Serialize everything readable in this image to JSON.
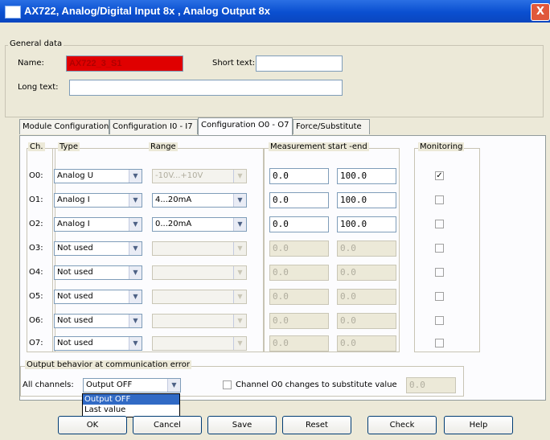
{
  "window": {
    "title": "AX722, Analog/Digital Input 8x , Analog Output 8x",
    "close_glyph": "X"
  },
  "general": {
    "group_title": "General data",
    "name_label": "Name:",
    "name_value": "AX722_3_S1",
    "short_text_label": "Short text:",
    "short_text_value": "",
    "long_text_label": "Long text:",
    "long_text_value": ""
  },
  "tabs": [
    {
      "label": "Module Configuration"
    },
    {
      "label": "Configuration I0 - I7"
    },
    {
      "label": "Configuration O0 - O7"
    },
    {
      "label": "Force/Substitute"
    }
  ],
  "columns": {
    "ch": "Ch.",
    "type": "Type",
    "range": "Range",
    "measurement": "Measurement start  -end",
    "monitoring": "Monitoring"
  },
  "rows": [
    {
      "ch": "O0:",
      "type": "Analog U",
      "range": "-10V...+10V",
      "start": "0.0",
      "end": "100.0",
      "monitor": "✓"
    },
    {
      "ch": "O1:",
      "type": "Analog I",
      "range": "4...20mA",
      "start": "0.0",
      "end": "100.0",
      "monitor": ""
    },
    {
      "ch": "O2:",
      "type": "Analog I",
      "range": "0...20mA",
      "start": "0.0",
      "end": "100.0",
      "monitor": ""
    },
    {
      "ch": "O3:",
      "type": "Not used",
      "range": "",
      "start": "0.0",
      "end": "0.0",
      "monitor": ""
    },
    {
      "ch": "O4:",
      "type": "Not used",
      "range": "",
      "start": "0.0",
      "end": "0.0",
      "monitor": ""
    },
    {
      "ch": "O5:",
      "type": "Not used",
      "range": "",
      "start": "0.0",
      "end": "0.0",
      "monitor": ""
    },
    {
      "ch": "O6:",
      "type": "Not used",
      "range": "",
      "start": "0.0",
      "end": "0.0",
      "monitor": ""
    },
    {
      "ch": "O7:",
      "type": "Not used",
      "range": "",
      "start": "0.0",
      "end": "0.0",
      "monitor": ""
    }
  ],
  "output_behavior": {
    "group_title": "Output behavior at communication error",
    "all_channels_label": "All channels:",
    "selected": "Output OFF",
    "options": [
      "Output OFF",
      "Last value"
    ],
    "substitute_label": "Channel O0 changes to substitute value",
    "substitute_value": "0.0"
  },
  "buttons": {
    "ok": "OK",
    "cancel": "Cancel",
    "save": "Save",
    "reset": "Reset",
    "check": "Check",
    "help": "Help"
  },
  "colors": {
    "title_bar": "#0a4fd0",
    "name_field": "#e00000",
    "selection": "#316ac5"
  },
  "icons": {
    "dropdown": "▼",
    "close": "X"
  }
}
